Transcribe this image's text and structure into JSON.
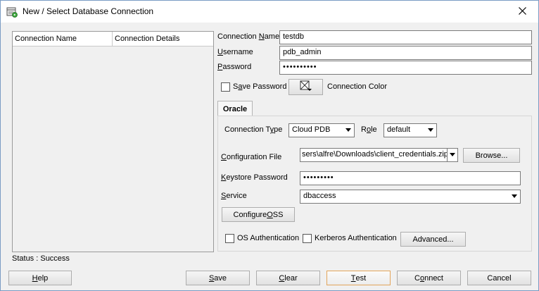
{
  "window": {
    "title": "New / Select Database Connection"
  },
  "connection_list": {
    "columns": [
      "Connection Name",
      "Connection Details"
    ]
  },
  "form": {
    "connection_name_label": "Connection Name",
    "connection_name_value": "testdb",
    "username_label": "Username",
    "username_value": "pdb_admin",
    "password_label": "Password",
    "password_value": "••••••••••",
    "save_password_label": "Save Password",
    "save_password_checked": false,
    "connection_color_label": "Connection Color"
  },
  "tabs": {
    "active": "Oracle"
  },
  "oracle": {
    "connection_type_label": "Connection Type",
    "connection_type_value": "Cloud PDB",
    "role_label": "Role",
    "role_value": "default",
    "config_file_label": "Configuration File",
    "config_file_value": "sers\\alfre\\Downloads\\client_credentials.zip",
    "browse_label": "Browse...",
    "keystore_password_label": "Keystore Password",
    "keystore_password_value": "•••••••••",
    "service_label": "Service",
    "service_value": "dbaccess",
    "configure_oss_label": "Configure OSS",
    "os_auth_label": "OS Authentication",
    "kerberos_auth_label": "Kerberos Authentication",
    "advanced_label": "Advanced..."
  },
  "status": {
    "text": "Status : Success"
  },
  "footer": {
    "help_label": "Help",
    "save_label": "Save",
    "clear_label": "Clear",
    "test_label": "Test",
    "connect_label": "Connect",
    "cancel_label": "Cancel"
  }
}
